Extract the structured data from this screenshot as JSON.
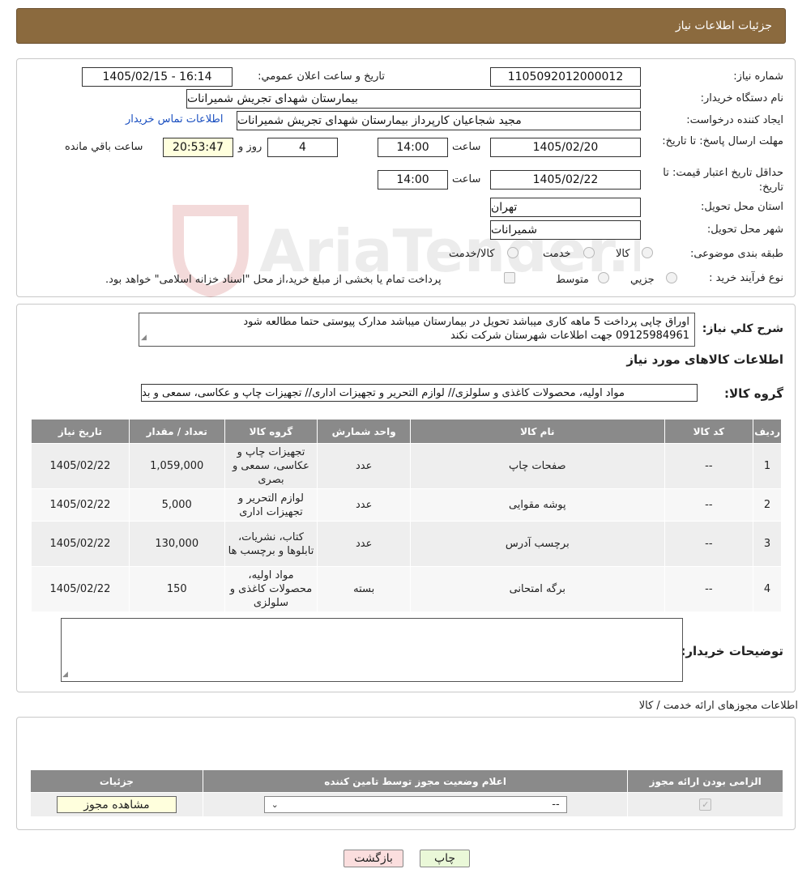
{
  "header": {
    "title": "جزئیات اطلاعات نیاز"
  },
  "watermark": {
    "text": "AriaTender.neT"
  },
  "form": {
    "need_number_label": "شماره نیاز:",
    "need_number": "1105092012000012",
    "announce_label": "تاریخ و ساعت اعلان عمومي:",
    "announce_value": "1405/02/15 - 16:14",
    "buyer_org_label": "نام دستگاه خریدار:",
    "buyer_org": "بیمارستان شهدای تجریش شمیرانات",
    "creator_label": "ایجاد کننده درخواست:",
    "creator": "مجید شجاعیان کارپرداز بیمارستان شهدای تجریش شمیرانات",
    "contact_link": "اطلاعات تماس خریدار",
    "deadline_label": "مهلت ارسال پاسخ: تا تاریخ:",
    "deadline_date": "1405/02/20",
    "time_label": "ساعت",
    "deadline_time": "14:00",
    "days_value": "4",
    "days_label": "روز و",
    "remaining_time": "20:53:47",
    "remaining_label": "ساعت باقي مانده",
    "validity_label": "حداقل تاریخ اعتبار قیمت: تا تاریخ:",
    "validity_date": "1405/02/22",
    "validity_time": "14:00",
    "province_label": "استان محل تحویل:",
    "province": "تهران",
    "city_label": "شهر محل تحویل:",
    "city": "شمیرانات",
    "category_label": "طبقه بندی موضوعی:",
    "category_options": [
      "کالا",
      "خدمت",
      "کالا/خدمت"
    ],
    "process_label": "نوع فرآیند خرید :",
    "process_options": [
      "جزیي",
      "متوسط"
    ],
    "process_note": "پرداخت تمام یا بخشی از مبلغ خرید،از محل \"اسناد خزانه اسلامی\" خواهد بود."
  },
  "description": {
    "label": "شرح کلي نیاز:",
    "line1": "اوراق چاپی پرداخت 5 ماهه کاری میباشد تحویل در بیمارستان میباشد مدارک پیوستی حتما مطالعه شود",
    "line2": "09125984961 جهت اطلاعات شهرستان شرکت نکند"
  },
  "goods": {
    "section_title": "اطلاعات کالاهای مورد نیاز",
    "group_label": "گروه کالا:",
    "group_value": "مواد اولیه، محصولات کاغذی و سلولزی// لوازم التحریر و تجهیزات اداری// تجهیزات چاپ و عکاسی، سمعی و بد",
    "columns": [
      "ردیف",
      "کد کالا",
      "نام کالا",
      "واحد شمارش",
      "گروه کالا",
      "تعداد / مقدار",
      "تاریخ نیاز"
    ],
    "rows": [
      {
        "idx": "1",
        "code": "--",
        "name": "صفحات چاپ",
        "unit": "عدد",
        "group": "تجهیزات چاپ و عکاسی، سمعی و بصری",
        "qty": "1,059,000",
        "date": "1405/02/22"
      },
      {
        "idx": "2",
        "code": "--",
        "name": "پوشه مقوایی",
        "unit": "عدد",
        "group": "لوازم التحریر و تجهیزات اداری",
        "qty": "5,000",
        "date": "1405/02/22"
      },
      {
        "idx": "3",
        "code": "--",
        "name": "برچسب آدرس",
        "unit": "عدد",
        "group": "کتاب، نشریات، تابلوها و برچسب ها",
        "qty": "130,000",
        "date": "1405/02/22"
      },
      {
        "idx": "4",
        "code": "--",
        "name": "برگه امتحانی",
        "unit": "بسته",
        "group": "مواد اولیه، محصولات کاغذی و سلولزی",
        "qty": "150",
        "date": "1405/02/22"
      }
    ]
  },
  "buyer_notes": {
    "label": "توضیحات خریدار:",
    "value": ""
  },
  "permits": {
    "section_title": "اطلاعات مجوزهای ارائه خدمت / کالا",
    "columns": [
      "الزامی بودن ارائه مجوز",
      "اعلام وضعیت مجوز توسط تامین کننده",
      "جزئیات"
    ],
    "select_value": "--",
    "view_button": "مشاهده مجوز"
  },
  "footer": {
    "print_button": "چاپ",
    "back_button": "بازگشت"
  },
  "colors": {
    "header_bg": "#8b6a3e",
    "table_header_bg": "#8a8a8a",
    "link": "#1a4fc0",
    "print_bg": "#eaf8d8",
    "back_bg": "#fbdede"
  }
}
